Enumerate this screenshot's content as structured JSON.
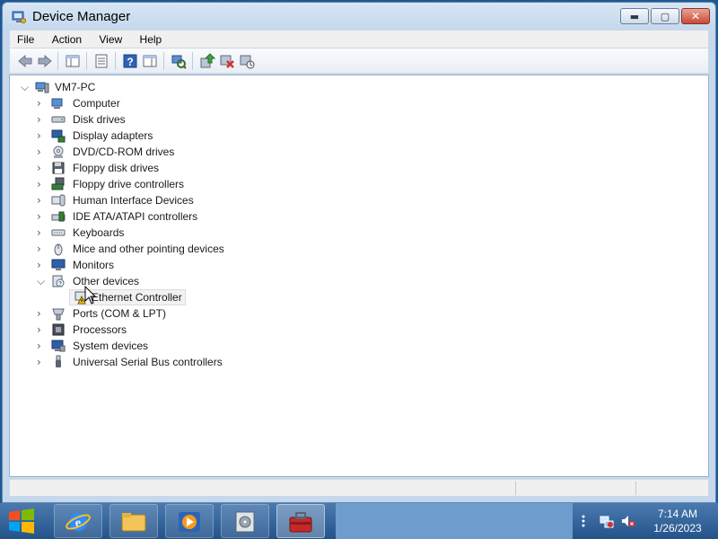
{
  "window": {
    "title": "Device Manager",
    "minimize_glyph": "▬",
    "maximize_glyph": "▢",
    "close_glyph": "✕"
  },
  "menu": [
    "File",
    "Action",
    "View",
    "Help"
  ],
  "toolbar": {
    "icons": [
      "back-arrow-icon",
      "forward-arrow-icon",
      "show-hide-console-tree-icon",
      "properties-icon",
      "help-icon",
      "show-action-pane-icon",
      "scan-hardware-changes-icon",
      "update-driver-icon",
      "uninstall-device-icon",
      "disable-device-icon"
    ]
  },
  "tree": {
    "root": {
      "label": "VM7-PC",
      "icon": "computer-icon",
      "expanded": true
    },
    "items": [
      {
        "label": "Computer",
        "icon": "computer-icon",
        "expanded": false
      },
      {
        "label": "Disk drives",
        "icon": "disk-drive-icon",
        "expanded": false
      },
      {
        "label": "Display adapters",
        "icon": "display-adapter-icon",
        "expanded": false
      },
      {
        "label": "DVD/CD-ROM drives",
        "icon": "dvd-icon",
        "expanded": false
      },
      {
        "label": "Floppy disk drives",
        "icon": "floppy-icon",
        "expanded": false
      },
      {
        "label": "Floppy drive controllers",
        "icon": "floppy-controller-icon",
        "expanded": false
      },
      {
        "label": "Human Interface Devices",
        "icon": "hid-icon",
        "expanded": false
      },
      {
        "label": "IDE ATA/ATAPI controllers",
        "icon": "ide-controller-icon",
        "expanded": false
      },
      {
        "label": "Keyboards",
        "icon": "keyboard-icon",
        "expanded": false
      },
      {
        "label": "Mice and other pointing devices",
        "icon": "mouse-icon",
        "expanded": false
      },
      {
        "label": "Monitors",
        "icon": "monitor-icon",
        "expanded": false
      },
      {
        "label": "Other devices",
        "icon": "unknown-device-icon",
        "expanded": true
      },
      {
        "label": "Ethernet Controller",
        "icon": "warning-device-icon",
        "child": true
      },
      {
        "label": "Ports (COM & LPT)",
        "icon": "port-icon",
        "expanded": false
      },
      {
        "label": "Processors",
        "icon": "processor-icon",
        "expanded": false
      },
      {
        "label": "System devices",
        "icon": "system-devices-icon",
        "expanded": false
      },
      {
        "label": "Universal Serial Bus controllers",
        "icon": "usb-icon",
        "expanded": false
      }
    ]
  },
  "taskbar": {
    "start_label": "Start",
    "buttons": [
      "internet-explorer-icon",
      "windows-explorer-icon",
      "media-player-icon",
      "disk-utility-icon",
      "toolbox-icon"
    ],
    "tray": {
      "time": "7:14 AM",
      "date": "1/26/2023"
    }
  },
  "colors": {
    "accent": "#1c5a96",
    "taskbar": "#3a6aa3",
    "selection": "#cce8ff"
  }
}
